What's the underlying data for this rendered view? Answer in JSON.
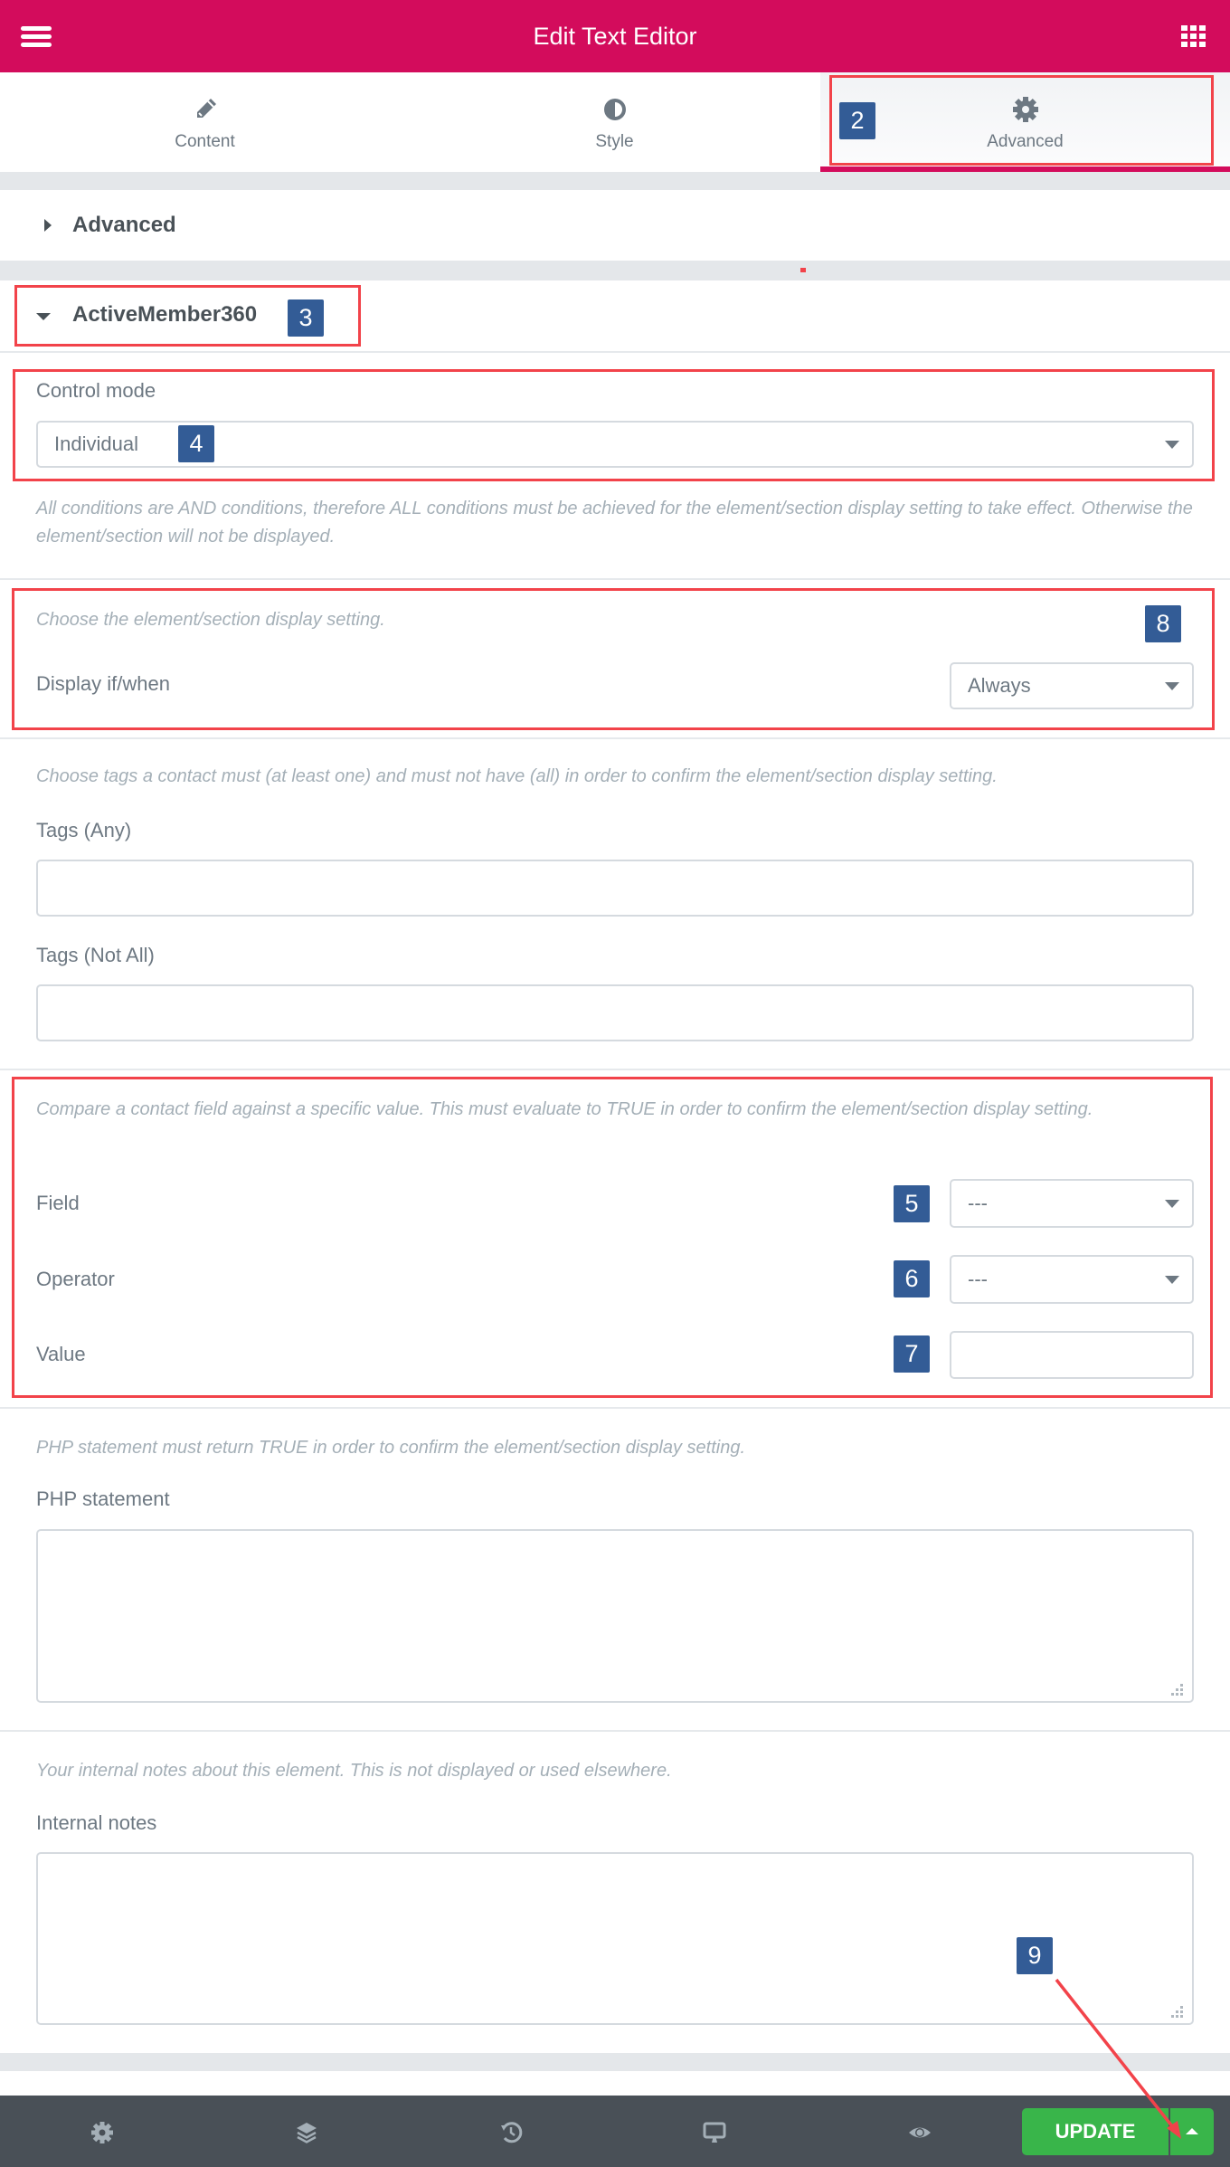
{
  "header": {
    "title": "Edit Text Editor",
    "menu_icon": "hamburger-icon",
    "apps_icon": "grid-icon"
  },
  "tabs": [
    {
      "label": "Content",
      "icon": "pencil-icon",
      "active": false
    },
    {
      "label": "Style",
      "icon": "half-circle-icon",
      "active": false
    },
    {
      "label": "Advanced",
      "icon": "gear-icon",
      "active": true
    }
  ],
  "sections": {
    "advanced": {
      "title": "Advanced",
      "expanded": false
    },
    "activemember": {
      "title": "ActiveMember360",
      "expanded": true
    }
  },
  "control_mode": {
    "label": "Control mode",
    "value": "Individual",
    "note": "All conditions are AND conditions, therefore ALL conditions must be achieved for the element/section display setting to take effect. Otherwise the element/section will not be displayed."
  },
  "display": {
    "note": "Choose the element/section display setting.",
    "label": "Display if/when",
    "value": "Always"
  },
  "tags": {
    "note": "Choose tags a contact must (at least one) and must not have (all) in order to confirm the element/section display setting.",
    "any_label": "Tags (Any)",
    "any_value": "",
    "not_all_label": "Tags (Not All)",
    "not_all_value": ""
  },
  "compare": {
    "note": "Compare a contact field against a specific value. This must evaluate to TRUE in order to confirm the element/section display setting.",
    "field_label": "Field",
    "field_value": "---",
    "operator_label": "Operator",
    "operator_value": "---",
    "value_label": "Value",
    "value_value": ""
  },
  "php": {
    "note": "PHP statement must return TRUE in order to confirm the element/section display setting.",
    "label": "PHP statement",
    "value": ""
  },
  "notes": {
    "note": "Your internal notes about this element. This is not displayed or used elsewhere.",
    "label": "Internal notes",
    "value": ""
  },
  "footer": {
    "icons": [
      "gear-icon",
      "layers-icon",
      "history-icon",
      "desktop-icon",
      "eye-icon"
    ],
    "update_label": "UPDATE"
  },
  "annotations": {
    "badges": [
      "2",
      "3",
      "4",
      "5",
      "6",
      "7",
      "8",
      "9"
    ],
    "color": "#f2434a",
    "badge_color": "#335c96"
  },
  "colors": {
    "brand": "#d30c5c",
    "update_green": "#39b54a",
    "footer_bg": "#495057"
  }
}
